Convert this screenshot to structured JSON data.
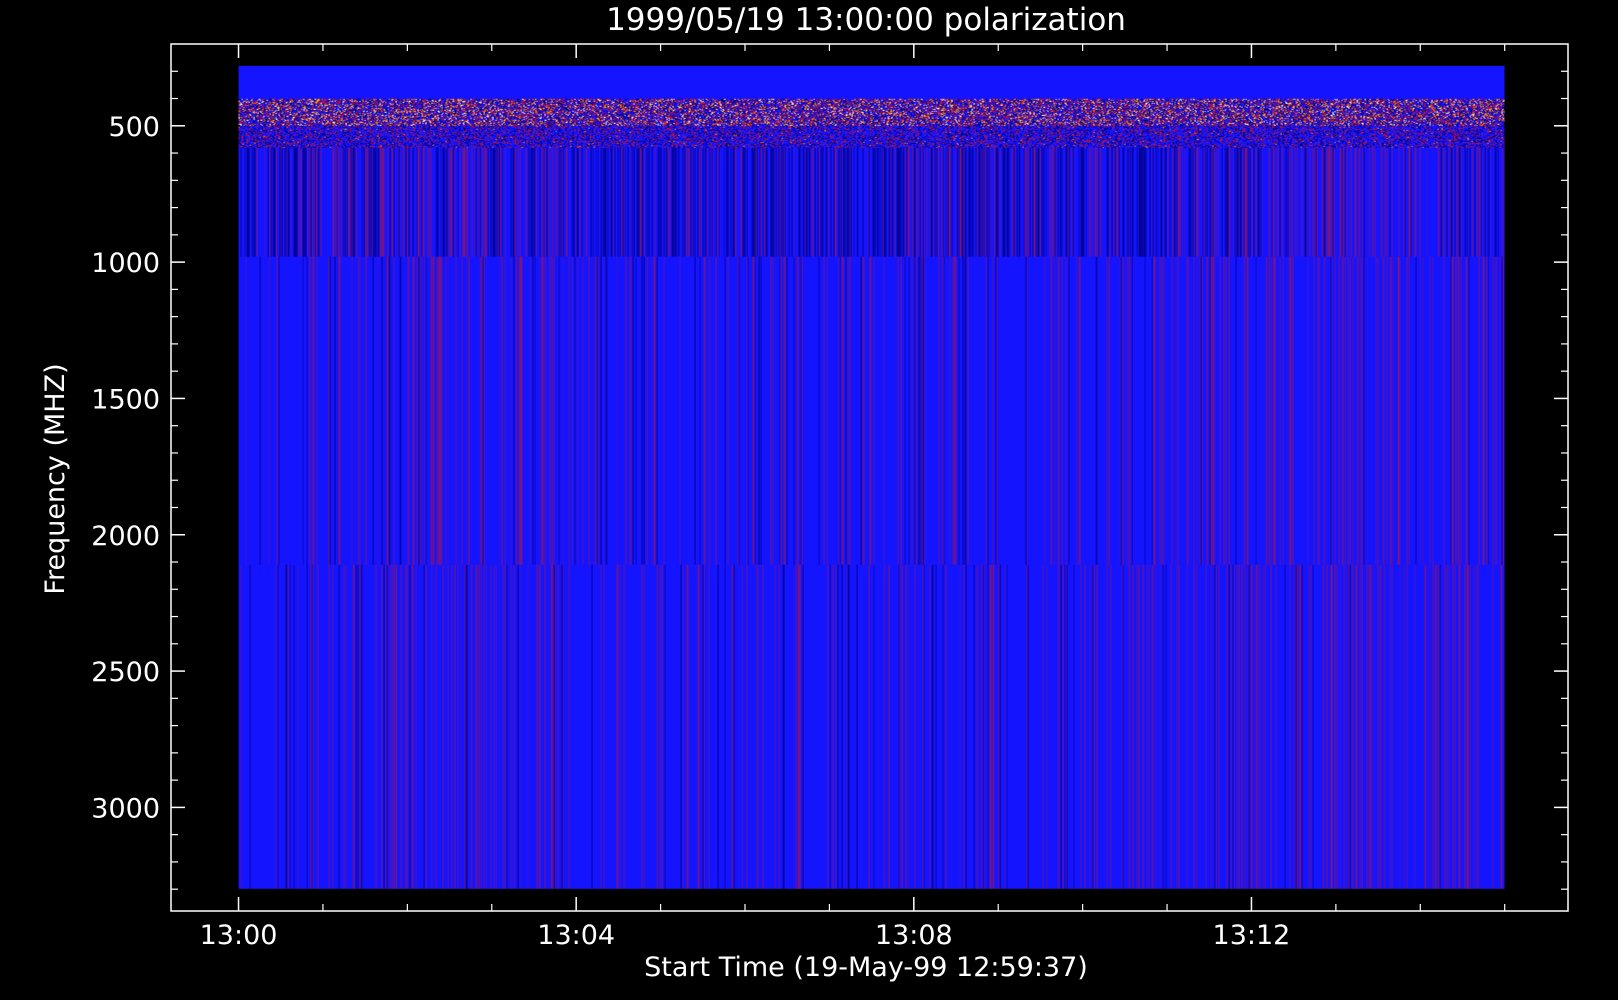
{
  "chart_data": {
    "type": "heatmap",
    "title": "1999/05/19 13:00:00 polarization",
    "xlabel": "Start Time (19-May-99 12:59:37)",
    "ylabel": "Frequency (MHZ)",
    "xticks": [
      "13:00",
      "13:04",
      "13:08",
      "13:12"
    ],
    "yticks": [
      "500",
      "1000",
      "1500",
      "2000",
      "2500",
      "3000"
    ],
    "ytick_values": [
      500,
      1000,
      1500,
      2000,
      2500,
      3000
    ],
    "xtick_minutes": [
      0,
      4,
      8,
      12
    ],
    "x_range_minutes": [
      -0.8,
      15.75
    ],
    "y_range_mhz": [
      200,
      3380
    ],
    "y_inverted": true,
    "data_time_range_minutes": [
      0,
      15
    ],
    "data_freq_range_mhz": [
      280,
      3300
    ],
    "bands": [
      {
        "freq_mhz": [
          280,
          400
        ],
        "level": "uniform"
      },
      {
        "freq_mhz": [
          400,
          580
        ],
        "level": "high_variability"
      },
      {
        "freq_mhz": [
          580,
          980
        ],
        "level": "medium_variability"
      },
      {
        "freq_mhz": [
          980,
          2110
        ],
        "level": "low_variability"
      },
      {
        "freq_mhz": [
          2110,
          3300
        ],
        "level": "low_variability"
      }
    ],
    "colors": {
      "background": "#000000",
      "axes": "#ffffff",
      "base": "#1414ff",
      "dark": "#000080",
      "red": "#b4143c",
      "hot": "#ffa000",
      "white": "#ffffff"
    },
    "grid": false,
    "legend": "none"
  }
}
